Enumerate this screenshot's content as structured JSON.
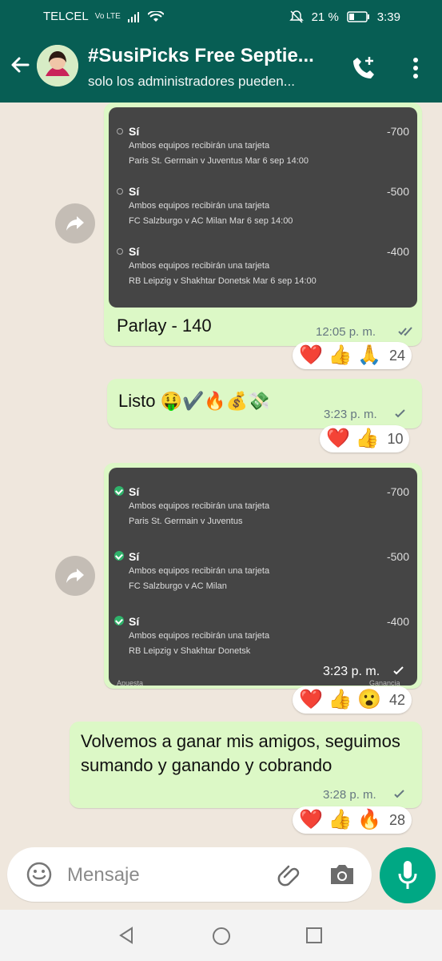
{
  "status": {
    "carrier": "TELCEL",
    "carrier_tag": "Vo LTE",
    "battery": "21 %",
    "time": "3:39"
  },
  "header": {
    "title": "#SusiPicks Free Septie...",
    "subtitle": "solo los administradores pueden..."
  },
  "messages": {
    "first": {
      "rows": [
        {
          "title": "Sí",
          "odds": "-700",
          "desc": "Ambos equipos recibirán una tarjeta",
          "match": "Paris St. Germain v Juventus   Mar 6 sep 14:00"
        },
        {
          "title": "Sí",
          "odds": "-500",
          "desc": "Ambos equipos recibirán una tarjeta",
          "match": "FC Salzburgo v AC Milan   Mar 6 sep 14:00"
        },
        {
          "title": "Sí",
          "odds": "-400",
          "desc": "Ambos equipos recibirán una tarjeta",
          "match": "RB Leipzig v Shakhtar Donetsk   Mar 6 sep 14:00"
        }
      ],
      "caption": "Parlay - 140",
      "time": "12:05 p. m.",
      "reactions": {
        "emojis": "❤️ 👍 🙏",
        "count": "24"
      }
    },
    "second": {
      "text": "Listo 🤑✔️🔥💰💸",
      "time": "3:23 p. m.",
      "reactions": {
        "emojis": "❤️ 👍",
        "count": "10"
      }
    },
    "third": {
      "rows": [
        {
          "title": "Sí",
          "odds": "-700",
          "desc": "Ambos equipos recibirán una tarjeta",
          "match": "Paris St. Germain v Juventus"
        },
        {
          "title": "Sí",
          "odds": "-500",
          "desc": "Ambos equipos recibirán una tarjeta",
          "match": "FC Salzburgo v AC Milan"
        },
        {
          "title": "Sí",
          "odds": "-400",
          "desc": "Ambos equipos recibirán una tarjeta",
          "match": "RB Leipzig v Shakhtar Donetsk"
        }
      ],
      "footer_left": "Apuesta",
      "footer_right": "Ganancia",
      "time": "3:23 p. m.",
      "reactions": {
        "emojis": "❤️ 👍 😮",
        "count": "42"
      }
    },
    "fourth": {
      "text": "Volvemos a ganar mis amigos, seguimos sumando y ganando y cobrando",
      "time": "3:28 p. m.",
      "reactions": {
        "emojis": "❤️ 👍 🔥",
        "count": "28"
      }
    }
  },
  "composer": {
    "placeholder": "Mensaje"
  },
  "colors": {
    "header": "#075e54",
    "bubble": "#dcf8c6",
    "send": "#00a884"
  },
  "icons": [
    "back-arrow-icon",
    "avatar-icon",
    "add-call-icon",
    "more-vert-icon",
    "forward-icon",
    "emoji-icon",
    "attachment-icon",
    "camera-icon",
    "mic-icon"
  ]
}
